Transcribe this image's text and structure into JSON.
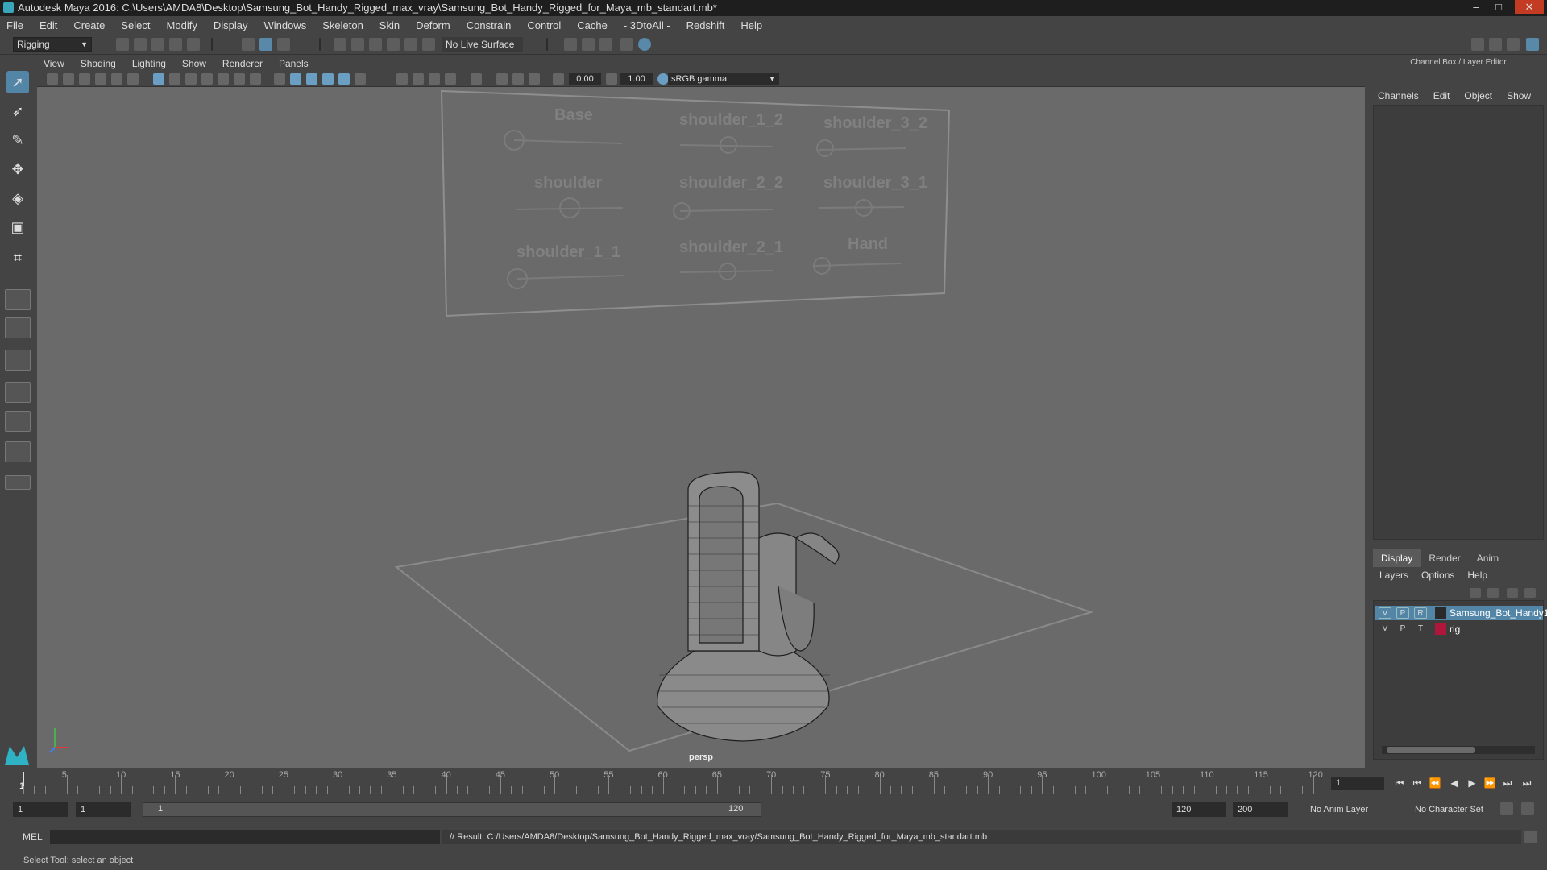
{
  "window": {
    "title": "Autodesk Maya 2016: C:\\Users\\AMDA8\\Desktop\\Samsung_Bot_Handy_Rigged_max_vray\\Samsung_Bot_Handy_Rigged_for_Maya_mb_standart.mb*",
    "min_glyph": "–",
    "max_glyph": "□",
    "close_glyph": "✕"
  },
  "menu": [
    "File",
    "Edit",
    "Create",
    "Select",
    "Modify",
    "Display",
    "Windows",
    "Skeleton",
    "Skin",
    "Deform",
    "Constrain",
    "Control",
    "Cache",
    "- 3DtoAll -",
    "Redshift",
    "Help"
  ],
  "status_line": {
    "mode": "Rigging",
    "live_surface": "No Live Surface"
  },
  "panel_menu": [
    "View",
    "Shading",
    "Lighting",
    "Show",
    "Renderer",
    "Panels"
  ],
  "panel_toolbar": {
    "exposure": "0.00",
    "gamma": "1.00",
    "color_space": "sRGB gamma"
  },
  "viewport": {
    "camera_label": "persp",
    "picker_labels": [
      "Base",
      "shoulder_1_2",
      "shoulder_3_2",
      "shoulder",
      "shoulder_2_2",
      "shoulder_3_1",
      "shoulder_1_1",
      "shoulder_2_1",
      "Hand"
    ]
  },
  "channel_box": {
    "title": "Channel Box / Layer Editor",
    "menu": [
      "Channels",
      "Edit",
      "Object",
      "Show"
    ]
  },
  "layer_editor": {
    "tabs": [
      "Display",
      "Render",
      "Anim"
    ],
    "menu": [
      "Layers",
      "Options",
      "Help"
    ],
    "layers": [
      {
        "v": "V",
        "p": "P",
        "r": "R",
        "name": "Samsung_Bot_Handy1",
        "color": "#2a2a2a",
        "selected": true
      },
      {
        "v": "V",
        "p": "P",
        "r": "T",
        "name": "rig",
        "color": "#b0163a",
        "selected": false
      }
    ]
  },
  "timeline": {
    "ticks": [
      "5",
      "10",
      "15",
      "20",
      "25",
      "30",
      "35",
      "40",
      "45",
      "50",
      "55",
      "60",
      "65",
      "70",
      "75",
      "80",
      "85",
      "90",
      "95",
      "100",
      "105",
      "110",
      "115",
      "120"
    ],
    "start_marker": "1",
    "current_frame": "1"
  },
  "playback_glyphs": [
    "⏮",
    "⏮",
    "⏪",
    "◀",
    "▶",
    "⏩",
    "⏭",
    "⏭"
  ],
  "range": {
    "start": "1",
    "playback_start": "1",
    "slider_start": "1",
    "slider_end": "120",
    "playback_end": "120",
    "end": "200",
    "anim_layer": "No Anim Layer",
    "character_set": "No Character Set"
  },
  "command_line": {
    "language": "MEL",
    "result": "// Result: C:/Users/AMDA8/Desktop/Samsung_Bot_Handy_Rigged_max_vray/Samsung_Bot_Handy_Rigged_for_Maya_mb_standart.mb"
  },
  "help_line": "Select Tool: select an object",
  "icons": {
    "select": "select-arrow-icon",
    "lasso": "lasso-icon",
    "paint": "paint-select-icon",
    "move": "move-icon",
    "rotate": "rotate-icon",
    "scale": "scale-icon",
    "manip": "universal-manip-icon"
  }
}
